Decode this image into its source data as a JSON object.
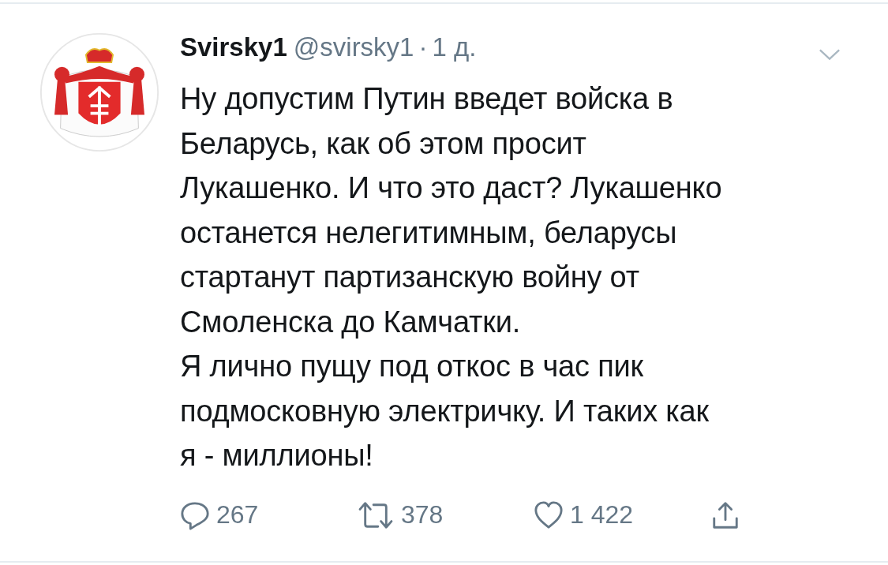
{
  "tweet": {
    "name": "Svirsky1",
    "handle": "@svirsky1",
    "separator": "·",
    "time": "1 д.",
    "text": "Ну допустим Путин введет войска в\nБеларусь, как об этом просит\nЛукашенко. И что это даст? Лукашенко\nостанется нелегитимным, беларусы\nстартанут партизанскую войну от\nСмоленска до Камчатки.\nЯ лично пущу под откос в час пик\nподмосковную электричку. И таких как\nя - миллионы!",
    "actions": [
      {
        "kind": "reply",
        "count": "267"
      },
      {
        "kind": "retweet",
        "count": "378"
      },
      {
        "kind": "like",
        "count": "1 422"
      },
      {
        "kind": "share"
      }
    ]
  }
}
